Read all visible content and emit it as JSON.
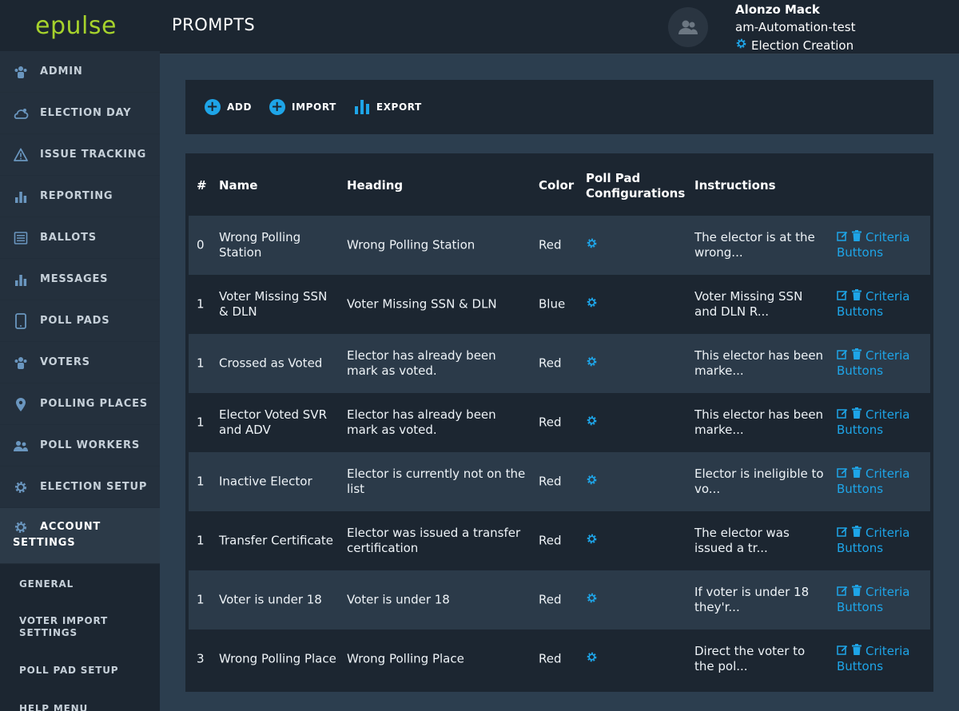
{
  "app": {
    "logo": "epulse",
    "page_title": "PROMPTS"
  },
  "user": {
    "name": "Alonzo Mack",
    "org": "am-Automation-test",
    "election": "Election Creation"
  },
  "sidebar": {
    "items": [
      {
        "label": "ADMIN",
        "icon": "users-icon"
      },
      {
        "label": "ELECTION DAY",
        "icon": "weather-icon"
      },
      {
        "label": "ISSUE TRACKING",
        "icon": "warning-icon"
      },
      {
        "label": "REPORTING",
        "icon": "bar-chart-icon"
      },
      {
        "label": "BALLOTS",
        "icon": "list-icon"
      },
      {
        "label": "MESSAGES",
        "icon": "bar-chart-icon"
      },
      {
        "label": "POLL PADS",
        "icon": "tablet-icon"
      },
      {
        "label": "VOTERS",
        "icon": "users-icon"
      },
      {
        "label": "POLLING PLACES",
        "icon": "map-pin-icon"
      },
      {
        "label": "POLL WORKERS",
        "icon": "people-icon"
      },
      {
        "label": "ELECTION SETUP",
        "icon": "gear-icon"
      },
      {
        "label": "ACCOUNT SETTINGS",
        "icon": "gear-icon"
      }
    ],
    "sub_items": [
      "GENERAL",
      "VOTER IMPORT SETTINGS",
      "POLL PAD SETUP",
      "HELP MENU"
    ]
  },
  "toolbar": {
    "add": "ADD",
    "import": "IMPORT",
    "export": "EXPORT"
  },
  "table": {
    "headers": {
      "num": "#",
      "name": "Name",
      "heading": "Heading",
      "color": "Color",
      "poll_pad": "Poll Pad Configurations",
      "instructions": "Instructions"
    },
    "action_criteria": "Criteria",
    "action_buttons": "Buttons",
    "rows": [
      {
        "num": "0",
        "name": "Wrong Polling Station",
        "heading": "Wrong Polling Station",
        "color": "Red",
        "instructions": "The elector is at the wrong..."
      },
      {
        "num": "1",
        "name": "Voter Missing SSN & DLN",
        "heading": "Voter Missing SSN & DLN",
        "color": "Blue",
        "instructions": "Voter Missing SSN and DLN R..."
      },
      {
        "num": "1",
        "name": "Crossed as Voted",
        "heading": "Elector has already been mark as voted.",
        "color": "Red",
        "instructions": "This elector has been marke..."
      },
      {
        "num": "1",
        "name": "Elector Voted SVR and ADV",
        "heading": "Elector has already been mark as voted.",
        "color": "Red",
        "instructions": "This elector has been marke..."
      },
      {
        "num": "1",
        "name": "Inactive Elector",
        "heading": "Elector is currently not on the list",
        "color": "Red",
        "instructions": "Elector is ineligible to vo..."
      },
      {
        "num": "1",
        "name": "Transfer Certificate",
        "heading": "Elector was issued a transfer certification",
        "color": "Red",
        "instructions": "The elector was issued a tr..."
      },
      {
        "num": "1",
        "name": "Voter is under 18",
        "heading": "Voter is under 18",
        "color": "Red",
        "instructions": "If voter is under 18 they'r..."
      },
      {
        "num": "3",
        "name": "Wrong Polling Place",
        "heading": "Wrong Polling Place",
        "color": "Red",
        "instructions": "Direct the voter to the pol..."
      }
    ]
  },
  "colors": {
    "accent": "#1ea5e8",
    "logo": "#a6d22c",
    "bg": "#2c3e4f",
    "panel": "#1c2631"
  }
}
